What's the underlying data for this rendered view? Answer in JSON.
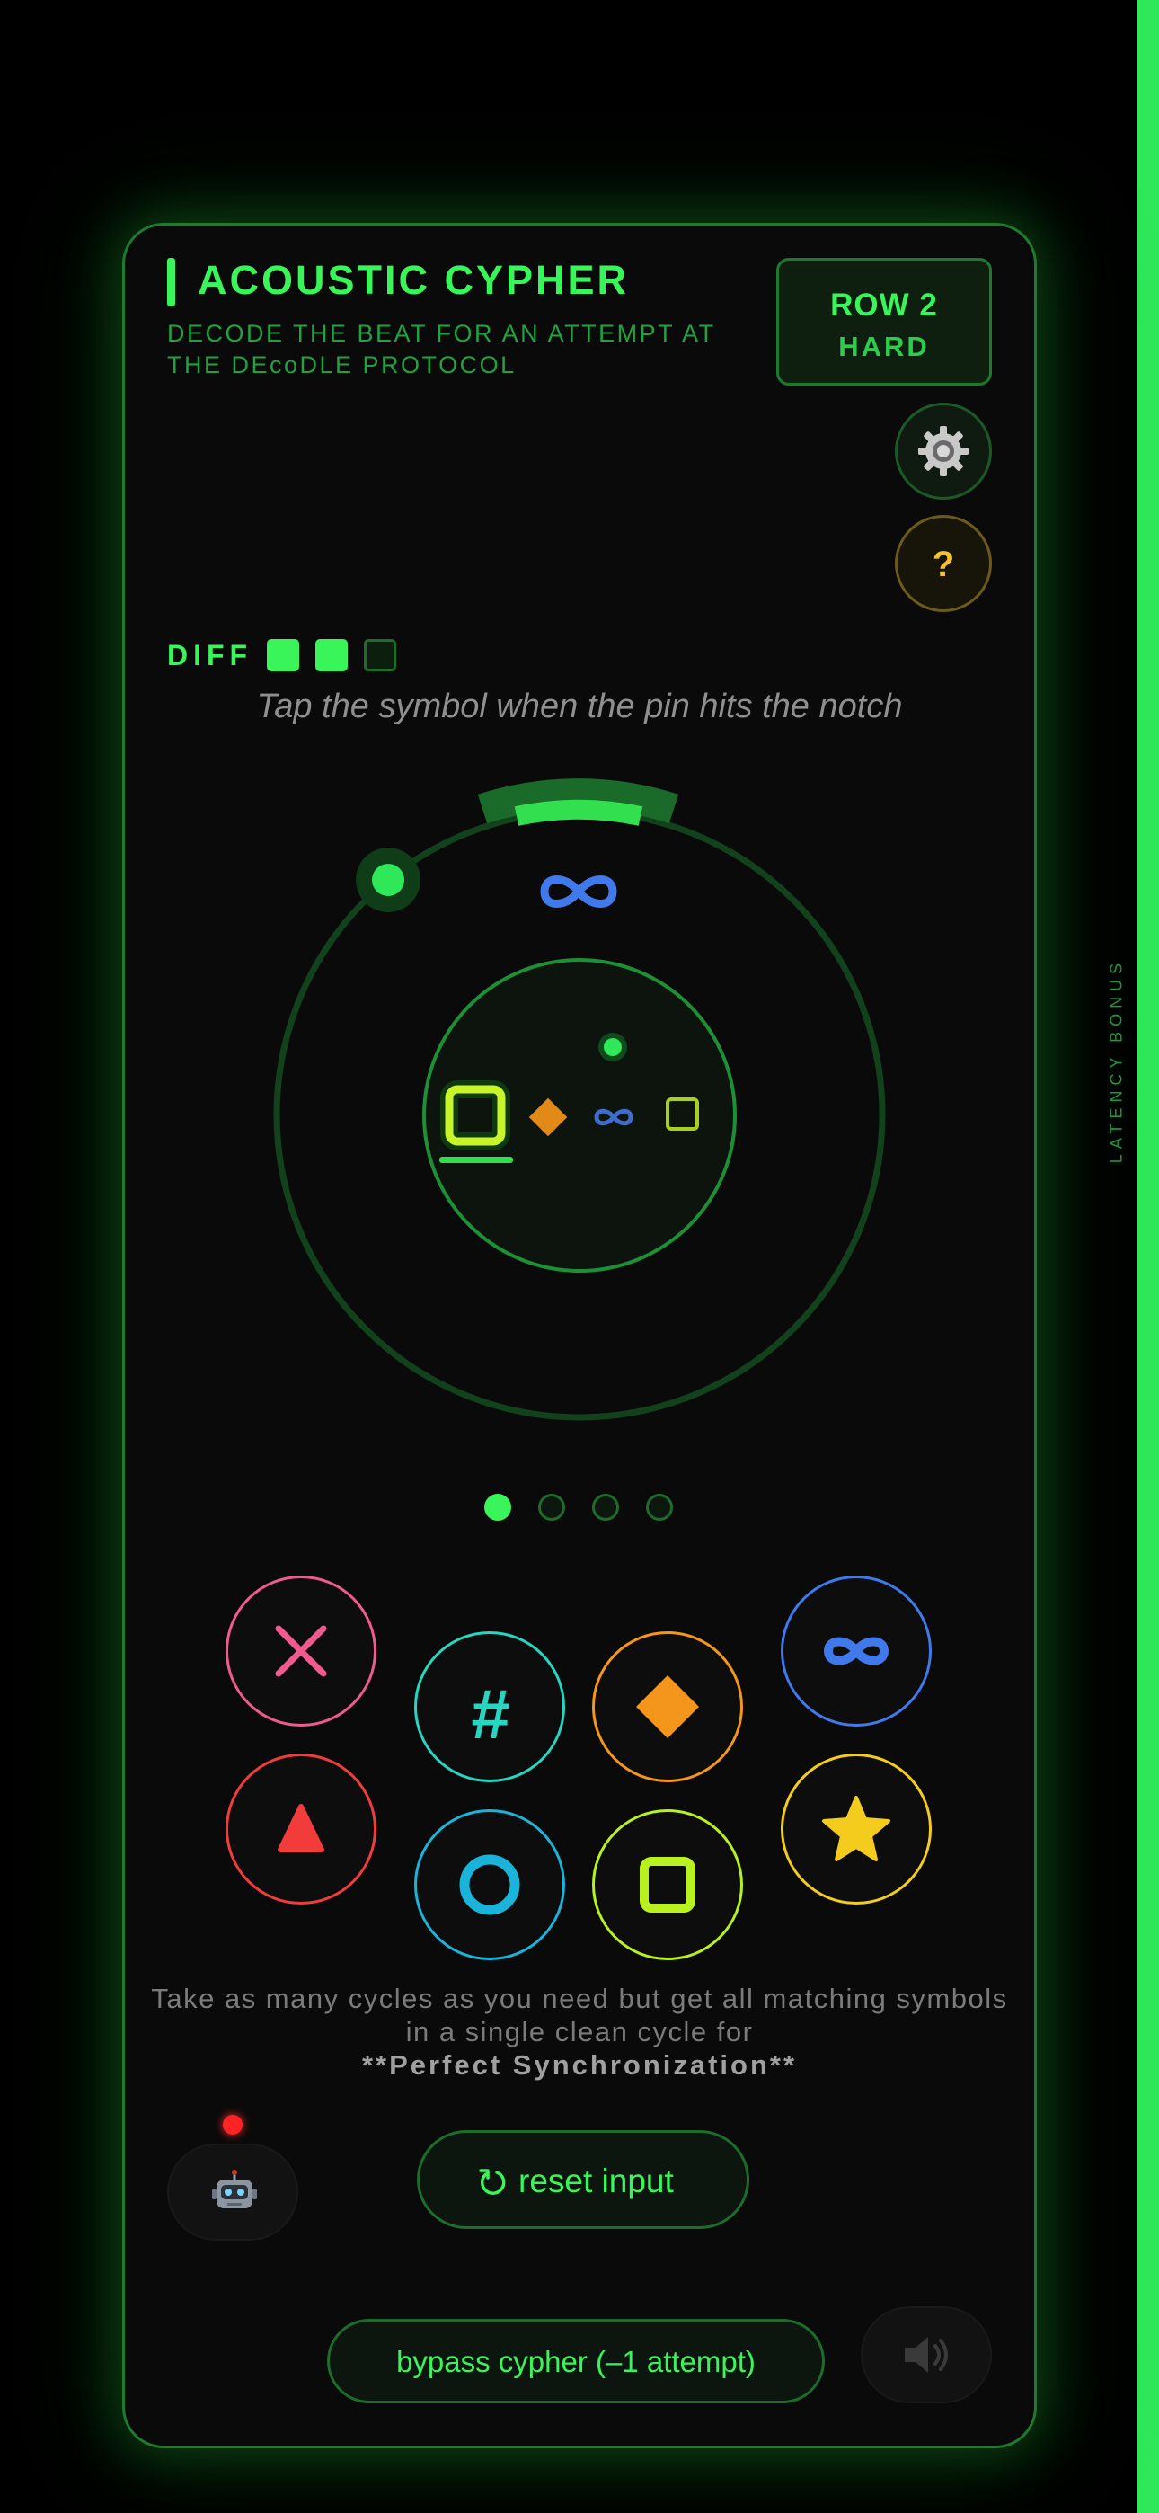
{
  "side_label": "LATENCY BONUS",
  "header": {
    "title": "ACOUSTIC CYPHER",
    "subtitle": "DECODE THE BEAT FOR AN ATTEMPT AT THE DEcoDLE PROTOCOL",
    "row_label": "ROW 2",
    "difficulty_name": "HARD",
    "help_label": "?"
  },
  "difficulty": {
    "label": "DIFF",
    "level": 2,
    "max": 3
  },
  "instruction": "Tap the symbol when the pin hits the notch",
  "sequence": {
    "current_target_icon": "infinity-icon",
    "symbols": [
      "square-icon",
      "diamond-icon",
      "infinity-icon",
      "square-icon"
    ],
    "active_index": 0
  },
  "progress": {
    "completed": 1,
    "total": 4
  },
  "buttons": [
    {
      "name": "x-button",
      "icon": "x-icon",
      "color": "#ef5a8f"
    },
    {
      "name": "triangle-button",
      "icon": "triangle-icon",
      "color": "#f23b3b"
    },
    {
      "name": "hash-button",
      "icon": "#",
      "color": "#27d6c0"
    },
    {
      "name": "circle-button",
      "icon": "circle-icon",
      "color": "#1ab3d9"
    },
    {
      "name": "diamond-button",
      "icon": "diamond-icon",
      "color": "#f5961c"
    },
    {
      "name": "square-button",
      "icon": "square-icon",
      "color": "#b9f01f"
    },
    {
      "name": "infinity-button",
      "icon": "infinity-icon",
      "color": "#3f79ec"
    },
    {
      "name": "star-button",
      "icon": "star-icon",
      "color": "#f3cc1d"
    }
  ],
  "hint": {
    "text": "Take as many cycles as you need but get all matching symbols in a single clean cycle for",
    "bold": "**Perfect Synchronization**"
  },
  "actions": {
    "reset_label": "reset input",
    "bypass_label": "bypass cypher (–1 attempt)",
    "bot_icon": "robot-icon",
    "sound_icon": "speaker-icon"
  },
  "colors": {
    "accent": "#39f55a",
    "border": "#1f7a30",
    "background": "#0a0a0a"
  }
}
